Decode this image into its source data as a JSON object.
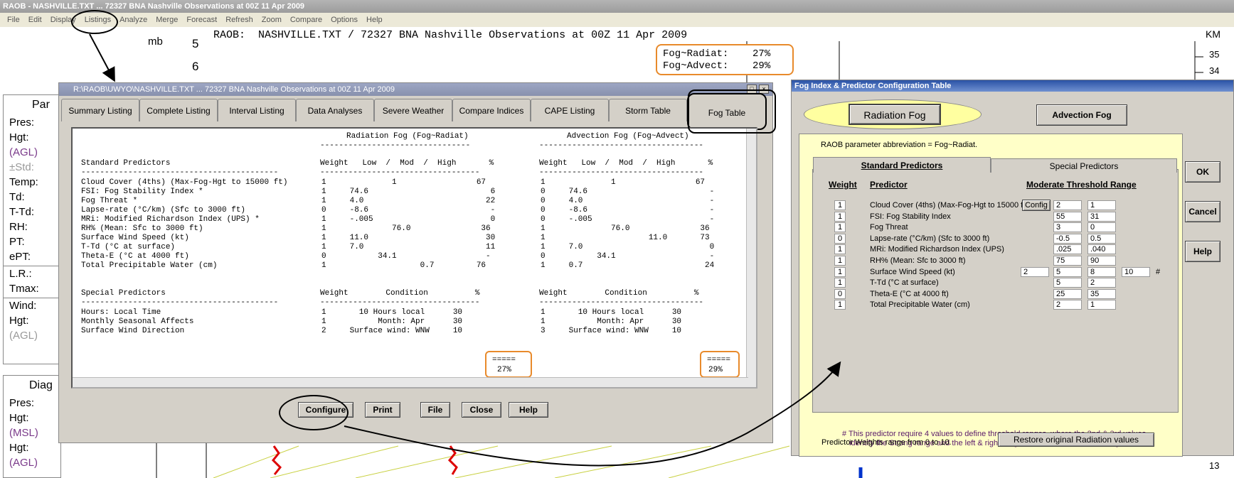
{
  "app": {
    "title": "RAOB - NASHVILLE.TXT ... 72327 BNA Nashville Observations at 00Z 11 Apr 2009",
    "menu": [
      "File",
      "Edit",
      "Display",
      "Listings",
      "Analyze",
      "Merge",
      "Forecast",
      "Refresh",
      "Zoom",
      "Compare",
      "Options",
      "Help"
    ]
  },
  "background": {
    "title": "RAOB:  NASHVILLE.TXT / 72327 BNA Nashville Observations at 00Z 11 Apr 2009",
    "mb_label": "mb",
    "ticks": [
      "5",
      "6"
    ],
    "km_label": "KM",
    "km_ticks": [
      "35",
      "34",
      "13"
    ],
    "fog_box": {
      "radiat": "Fog~Radiat:    27%",
      "advect": "Fog~Advect:    29%"
    },
    "left_panel1": {
      "header": "Par",
      "rows": [
        "Pres:",
        "Hgt:",
        "(AGL)",
        "±Std:",
        "Temp:",
        "Td:",
        "T-Td:",
        "RH:",
        "PT:",
        "ePT:"
      ],
      "rows2": [
        "L.R.:",
        "Tmax:"
      ],
      "rows3": [
        "Wind:",
        "Hgt:",
        "(AGL)"
      ]
    },
    "left_panel2": {
      "header": "Diag",
      "rows": [
        "Pres:",
        "Hgt:",
        "(MSL)",
        "Hgt:",
        "(AGL)"
      ]
    }
  },
  "dialog": {
    "title": "R:\\RAOB\\UWYO\\NASHVILLE.TXT ... 72327 BNA Nashville Observations at 00Z 11 Apr 2009",
    "tabs": [
      "Summary Listing",
      "Complete Listing",
      "Interval Listing",
      "Data Analyses",
      "Severe Weather",
      "Compare Indices",
      "CAPE Listing",
      "Storm Table",
      "Fog Table"
    ],
    "report": {
      "rad_header": "Radiation Fog (Fog~Radiat)",
      "adv_header": "Advection Fog (Fog~Advect)",
      "std_title": "Standard Predictors",
      "col_heads": "Weight   Low  /  Mod  /  High       %",
      "col_heads2": "Weight   Low  /  Mod  /  High       %",
      "std_rows": [
        {
          "name": "Cloud Cover (4ths) (Max-Fog-Hgt to 15000 ft)",
          "r": "1              1                 67",
          "a": "1              1                 67"
        },
        {
          "name": "FSI: Fog Stability Index *",
          "r": "1     74.6                          6",
          "a": "0     74.6                          -"
        },
        {
          "name": "Fog Threat *",
          "r": "1     4.0                          22",
          "a": "0     4.0                           -"
        },
        {
          "name": "Lapse-rate (°C/km) (Sfc to 3000 ft)",
          "r": "0     -8.6                          -",
          "a": "0     -8.6                          -"
        },
        {
          "name": "MRi: Modified Richardson Index (UPS) *",
          "r": "1     -.005                         0",
          "a": "0     -.005                         -"
        },
        {
          "name": "RH% (Mean: Sfc to 3000 ft)",
          "r": "1              76.0               36",
          "a": "1              76.0               36"
        },
        {
          "name": "Surface Wind Speed (kt)",
          "r": "1     11.0                         30",
          "a": "1                      11.0       73"
        },
        {
          "name": "T-Td (°C at surface)",
          "r": "1     7.0                          11",
          "a": "1     7.0                           0"
        },
        {
          "name": "Theta-E (°C at 4000 ft)",
          "r": "0           34.1                   -",
          "a": "0           34.1                    -"
        },
        {
          "name": "Total Precipitable Water (cm)",
          "r": "1                    0.7         76",
          "a": "1     0.7                          24"
        }
      ],
      "spec_title": "Special Predictors",
      "spec_heads": "Weight        Condition          %",
      "spec_heads2": "Weight        Condition          %",
      "spec_rows": [
        {
          "name": "Hours: Local Time",
          "r": "1       10 Hours local      30",
          "a": "1       10 Hours local      30"
        },
        {
          "name": "Monthly Seasonal Affects",
          "r": "1           Month: Apr      30",
          "a": "1           Month: Apr      30"
        },
        {
          "name": "Surface Wind Direction",
          "r": "2     Surface wind: WNW     10",
          "a": "3     Surface wind: WNW     10"
        }
      ],
      "sep": "=====",
      "rad_total": "27%",
      "adv_total": "29%"
    },
    "buttons": [
      "Configure",
      "Print",
      "File",
      "Close",
      "Help"
    ]
  },
  "config": {
    "title": "Fog Index & Predictor Configuration Table",
    "radiation_btn": "Radiation Fog",
    "advection_btn": "Advection Fog",
    "abbr": "RAOB parameter abbreviation = Fog~Radiat.",
    "tab_std": "Standard Predictors",
    "tab_spec": "Special Predictors",
    "col_weight": "Weight",
    "col_predictor": "Predictor",
    "col_range": "Moderate Threshold Range",
    "rows": [
      {
        "w": "1",
        "name": "Cloud Cover (4ths) (Max-Fog-Hgt to 15000 ft)",
        "config": "Config",
        "v": [
          "2",
          "1"
        ]
      },
      {
        "w": "1",
        "name": "FSI: Fog Stability Index",
        "v": [
          "55",
          "31"
        ]
      },
      {
        "w": "1",
        "name": "Fog Threat",
        "v": [
          "3",
          "0"
        ]
      },
      {
        "w": "0",
        "name": "Lapse-rate (°C/km) (Sfc to 3000 ft)",
        "v": [
          "-0.5",
          "0.5"
        ]
      },
      {
        "w": "1",
        "name": "MRi: Modified Richardson Index (UPS)",
        "v": [
          ".025",
          ".040"
        ]
      },
      {
        "w": "1",
        "name": "RH% (Mean: Sfc to 3000 ft)",
        "v": [
          "75",
          "90"
        ]
      },
      {
        "w": "1",
        "name": "Surface Wind Speed (kt)",
        "v": [
          "5",
          "8"
        ],
        "left": "2",
        "right": "10",
        "hash": "#"
      },
      {
        "w": "1",
        "name": "T-Td (°C at surface)",
        "v": [
          "5",
          "2"
        ]
      },
      {
        "w": "0",
        "name": "Theta-E (°C at 4000 ft)",
        "v": [
          "25",
          "35"
        ]
      },
      {
        "w": "1",
        "name": "Total Precipitable Water (cm)",
        "v": [
          "2",
          "1"
        ]
      }
    ],
    "note1": "# This predictor require 4 values to define threshold ranges, where the 2nd & 3rd values",
    "note2": "identify the Strong range and the left & right ranges define the Moderate categories.",
    "weights_note": "Predictor Weights range from 0 to 10.",
    "restore_btn": "Restore original Radiation values",
    "ok": "OK",
    "cancel": "Cancel",
    "help": "Help"
  }
}
